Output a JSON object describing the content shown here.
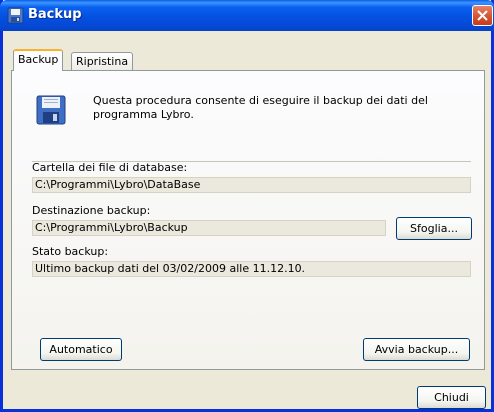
{
  "window": {
    "title": "Backup"
  },
  "tabs": [
    {
      "label": "Backup",
      "active": true
    },
    {
      "label": "Ripristina",
      "active": false
    }
  ],
  "description": "Questa procedura consente di eseguire il backup dei dati del programma Lybro.",
  "database_folder": {
    "label": "Cartella dei file di database:",
    "value": "C:\\Programmi\\Lybro\\DataBase"
  },
  "destination": {
    "label": "Destinazione backup:",
    "value": "C:\\Programmi\\Lybro\\Backup",
    "browse_label": "Sfoglia..."
  },
  "status": {
    "label": "Stato backup:",
    "value": "Ultimo backup dati del 03/02/2009 alle 11.12.10."
  },
  "buttons": {
    "automatic": "Automatico",
    "start": "Avvia backup...",
    "close": "Chiudi"
  },
  "icons": {
    "title": "save-icon",
    "panel": "floppy-disk-icon",
    "close": "close-icon"
  },
  "colors": {
    "titlebar": "#0a5fe8",
    "window_bg": "#ece9d8",
    "close_button": "#d4502e",
    "tab_highlight": "#f9b12e"
  }
}
